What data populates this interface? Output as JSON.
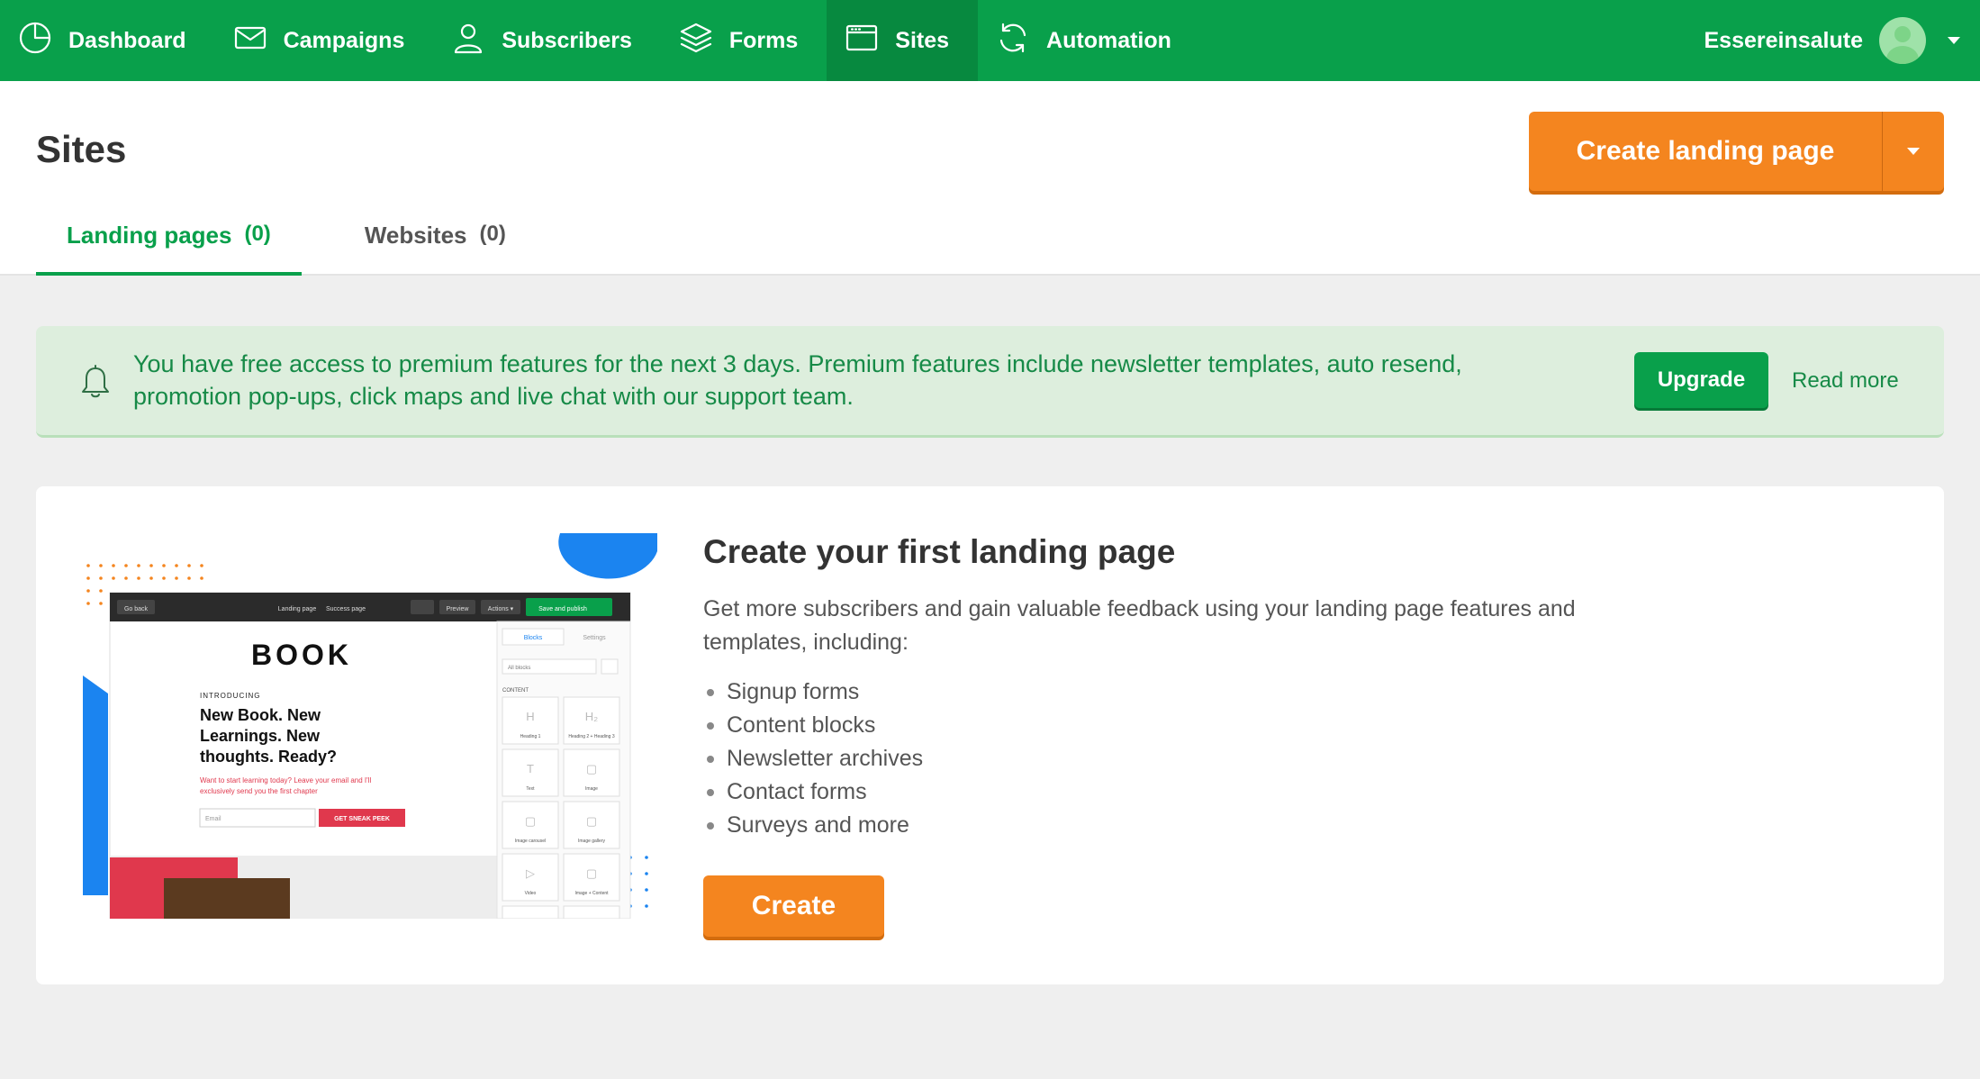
{
  "nav": {
    "items": [
      {
        "label": "Dashboard",
        "icon": "pie-chart-icon"
      },
      {
        "label": "Campaigns",
        "icon": "envelope-icon"
      },
      {
        "label": "Subscribers",
        "icon": "person-icon"
      },
      {
        "label": "Forms",
        "icon": "layers-icon"
      },
      {
        "label": "Sites",
        "icon": "browser-window-icon",
        "active": true
      },
      {
        "label": "Automation",
        "icon": "refresh-icon"
      }
    ],
    "user": "Essereinsalute"
  },
  "header": {
    "title": "Sites",
    "create_button": "Create landing page",
    "tabs": [
      {
        "label": "Landing pages",
        "count": "(0)",
        "active": true
      },
      {
        "label": "Websites",
        "count": "(0)"
      }
    ]
  },
  "notice": {
    "message": "You have free access to premium features for the next 3 days. Premium features include newsletter templates, auto resend, promotion pop-ups, click maps and live chat with our support team.",
    "upgrade": "Upgrade",
    "read_more": "Read more"
  },
  "card": {
    "title": "Create your first landing page",
    "description": "Get more subscribers and gain valuable feedback using your landing page features and templates, including:",
    "features": [
      "Signup forms",
      "Content blocks",
      "Newsletter archives",
      "Contact forms",
      "Surveys and more"
    ],
    "create": "Create"
  },
  "preview": {
    "go_back": "Go back",
    "landing_page": "Landing page",
    "success_page": "Success page",
    "preview": "Preview",
    "actions": "Actions ▾",
    "save_publish": "Save and publish",
    "logo": "BOOK",
    "introducing": "INTRODUCING",
    "headline": [
      "New Book. New",
      "Learnings. New",
      "thoughts. Ready?"
    ],
    "subtext": [
      "Want to start learning today? Leave your email and I'll",
      "exclusively send you the first chapter"
    ],
    "email": "Email",
    "cta": "GET SNEAK PEEK",
    "tab_blocks": "Blocks",
    "tab_settings": "Settings",
    "all_blocks": "All blocks",
    "content": "CONTENT",
    "blocks": [
      "Heading 1",
      "Heading 2 + Heading 3",
      "Text",
      "Image",
      "Image carousel",
      "Image gallery",
      "Video",
      "Image + Content"
    ]
  },
  "colors": {
    "brand_green": "#09a04b",
    "accent_orange": "#f4851f",
    "notice_bg": "#ddeedd"
  }
}
